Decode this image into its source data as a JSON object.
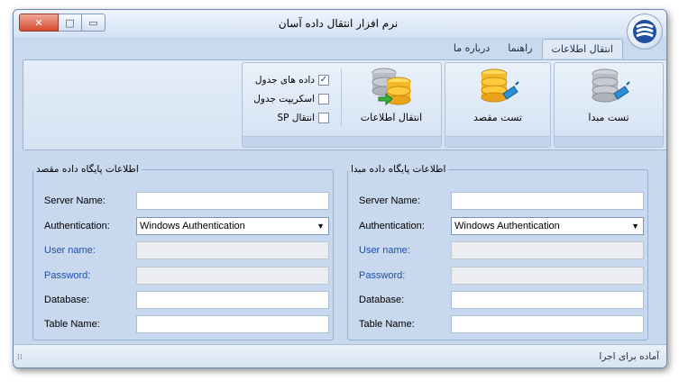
{
  "window": {
    "title": "نرم افزار انتقال داده آسان",
    "controls": {
      "close": "✕",
      "maximize": "□",
      "minimize": "▭"
    }
  },
  "tabs": [
    {
      "label": "انتقال اطلاعات",
      "active": true
    },
    {
      "label": "راهنما",
      "active": false
    },
    {
      "label": "درباره ما",
      "active": false
    }
  ],
  "ribbon": {
    "test_source": "تست مبدا",
    "test_target": "تست مقصد",
    "transfer": "انتقال اطلاعات",
    "options": [
      {
        "label": "داده های جدول",
        "checked": true
      },
      {
        "label": "اسکریپت جدول",
        "checked": false
      },
      {
        "label": "انتقال SP",
        "checked": false
      }
    ]
  },
  "source_db": {
    "legend": "اطلاعات پایگاه داده مبدا",
    "server_label": "Server Name:",
    "server_value": "",
    "auth_label": "Authentication:",
    "auth_value": "Windows Authentication",
    "user_label": "User name:",
    "user_value": "",
    "password_label": "Password:",
    "password_value": "",
    "database_label": "Database:",
    "database_value": "",
    "table_label": "Table Name:",
    "table_value": ""
  },
  "target_db": {
    "legend": "اطلاعات پایگاه داده مقصد",
    "server_label": "Server Name:",
    "server_value": "",
    "auth_label": "Authentication:",
    "auth_value": "Windows Authentication",
    "user_label": "User name:",
    "user_value": "",
    "password_label": "Password:",
    "password_value": "",
    "database_label": "Database:",
    "database_value": "",
    "table_label": "Table Name:",
    "table_value": ""
  },
  "status": {
    "text": "آماده برای اجرا"
  },
  "colors": {
    "accent_blue": "#2050a8",
    "frame": "#c9d9ee",
    "close_red": "#d44a2f"
  }
}
